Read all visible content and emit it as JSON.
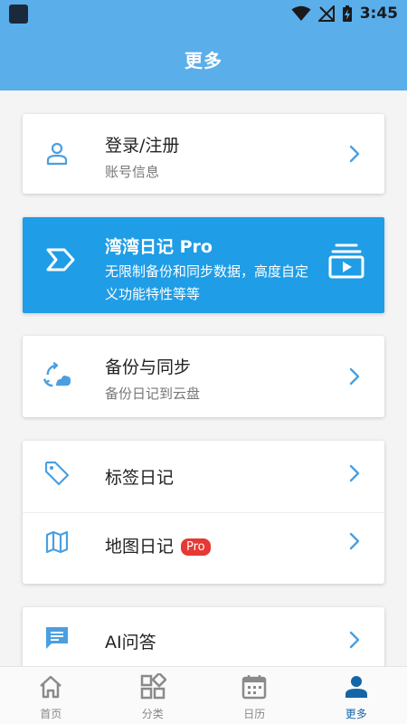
{
  "status_bar": {
    "time": "3:45"
  },
  "header": {
    "title": "更多"
  },
  "account": {
    "title": "登录/注册",
    "subtitle": "账号信息"
  },
  "promo": {
    "title": "湾湾日记 Pro",
    "description": "无限制备份和同步数据，高度自定义功能特性等等"
  },
  "backup": {
    "title": "备份与同步",
    "subtitle": "备份日记到云盘"
  },
  "tags": {
    "title": "标签日记"
  },
  "map": {
    "title": "地图日记",
    "badge": "Pro"
  },
  "ai": {
    "title": "AI问答"
  },
  "bottom_nav": {
    "items": [
      {
        "label": "首页",
        "icon": "home-icon"
      },
      {
        "label": "分类",
        "icon": "category-icon"
      },
      {
        "label": "日历",
        "icon": "calendar-icon"
      },
      {
        "label": "更多",
        "icon": "person-icon"
      }
    ],
    "active_index": 3
  },
  "colors": {
    "header_bg": "#5aaeea",
    "promo_bg": "#1f9de6",
    "icon_blue": "#4a9fe0",
    "badge_red": "#e53935",
    "active_nav": "#1565a6",
    "inactive_nav": "#888888"
  }
}
